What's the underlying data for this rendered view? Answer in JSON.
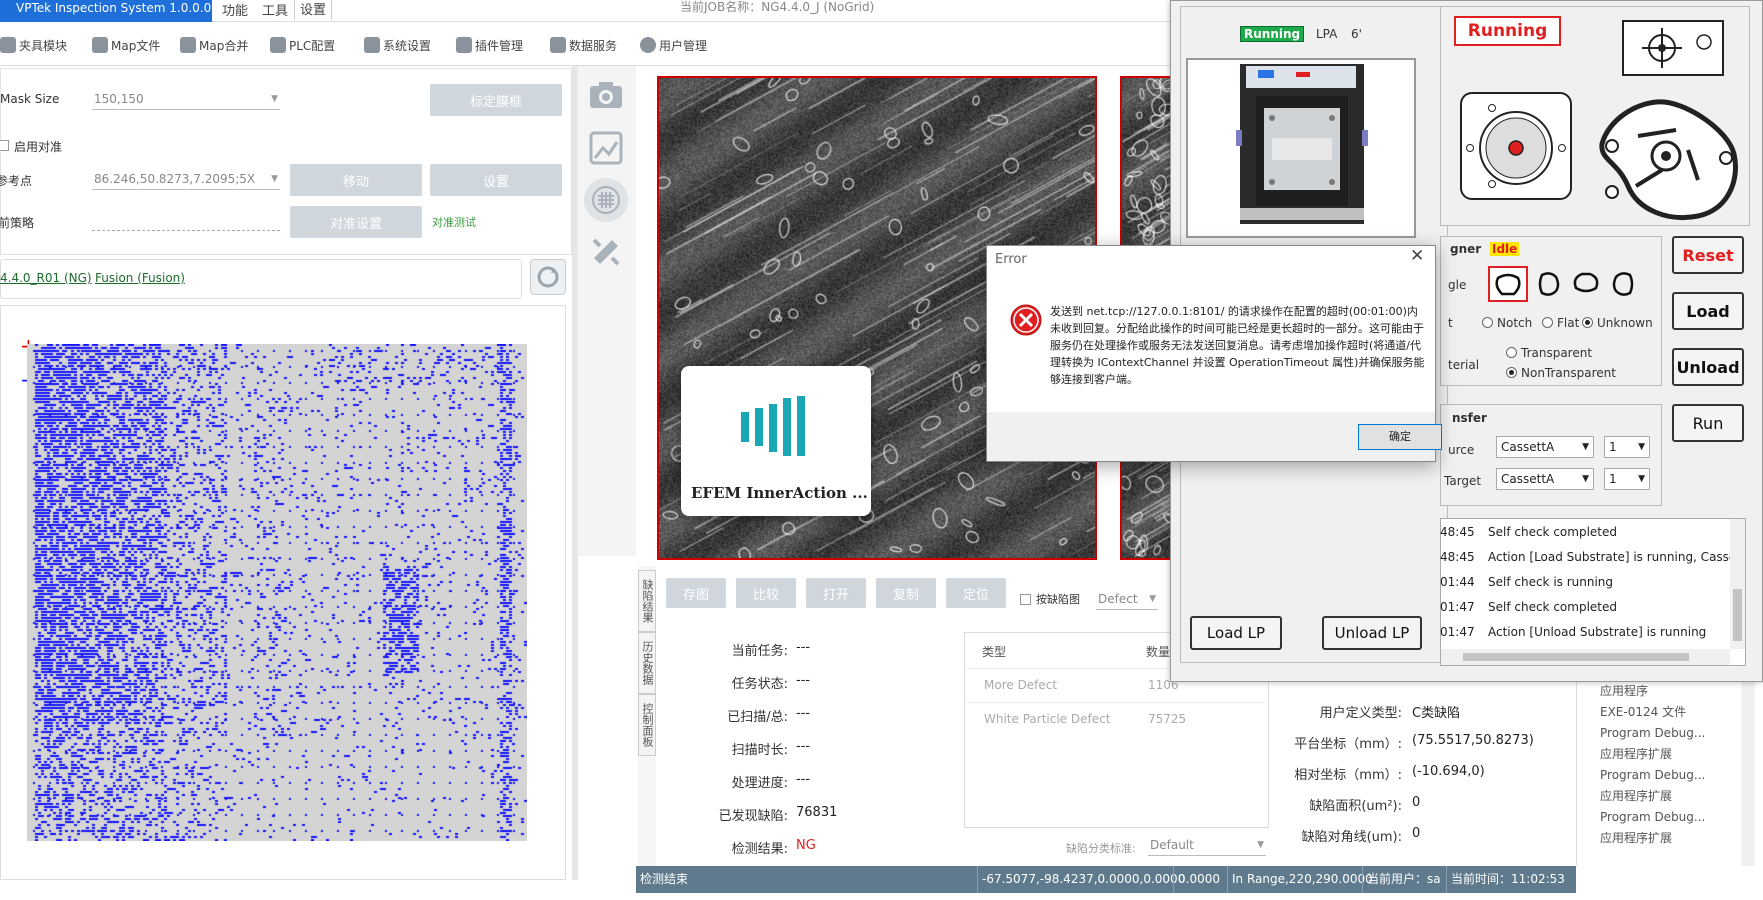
{
  "app": {
    "title": "VPTek Inspection System 1.0.0.0",
    "menu": [
      "功能",
      "工具",
      "设置"
    ],
    "job": "当前JOB名称：NG4.4.0_J (NoGrid)"
  },
  "toolbar": [
    "夹具模块",
    "Map文件",
    "Map合并",
    "PLC配置",
    "系统设置",
    "插件管理",
    "数据服务",
    "用户管理"
  ],
  "left": {
    "mask_size_label": "Mask Size",
    "mask_size_value": "150,150",
    "mark_button": "标定膜框",
    "enable_align": "启用对准",
    "ref_point_label": "参考点",
    "ref_point_value": "86.246,50.8273,7.2095;5X",
    "move_button": "移动",
    "set_button": "设置",
    "strategy_label": "前策略",
    "align_settings_button": "对准设置",
    "align_test": "对准测试",
    "recipe_link": "4.4.0_R01 (NG)",
    "fusion_link": "Fusion (Fusion)"
  },
  "inspection": {
    "buttons": [
      "存图",
      "比较",
      "打开",
      "复制",
      "定位"
    ],
    "by_defect_map": "按缺陷图",
    "defect_select": "Defect",
    "vtabs": [
      "缺陷结果",
      "历史数据",
      "控制面板"
    ],
    "stats": [
      {
        "label": "当前任务:",
        "value": "---"
      },
      {
        "label": "任务状态:",
        "value": "---"
      },
      {
        "label": "已扫描/总:",
        "value": "---"
      },
      {
        "label": "扫描时长:",
        "value": "---"
      },
      {
        "label": "处理进度:",
        "value": "---"
      },
      {
        "label": "已发现缺陷:",
        "value": "76831"
      },
      {
        "label": "检测结果:",
        "value": "NG"
      }
    ],
    "table_headers": [
      "类型",
      "数量"
    ],
    "table_rows": [
      [
        "More Defect",
        "1106"
      ],
      [
        "White Particle Defect",
        "75725"
      ]
    ],
    "classify_label": "缺陷分类标准:",
    "classify_value": "Default"
  },
  "detail": [
    {
      "label": "用户定义类型:",
      "value": "C类缺陷"
    },
    {
      "label": "平台坐标（mm）:",
      "value": "(75.5517,50.8273)"
    },
    {
      "label": "相对坐标（mm）:",
      "value": "(-10.694,0)"
    },
    {
      "label": "缺陷面积(um²):",
      "value": "0"
    },
    {
      "label": "缺陷对角线(um):",
      "value": "0"
    }
  ],
  "right_list": [
    "应用程序",
    "EXE-0124 文件",
    "Program Debug...",
    "应用程序扩展",
    "Program Debug...",
    "应用程序扩展",
    "Program Debug...",
    "应用程序扩展"
  ],
  "status_bar": [
    "检测结束",
    "-67.5077,-98.4237,0.0000,0.0000",
    "0.0000",
    "In Range,220,290.0000",
    "当前用户：sa",
    "当前时间：11:02:53"
  ],
  "splash": {
    "title": "EFEM InnerAction ..."
  },
  "efem": {
    "lp_status": "Running",
    "lp_label": "LPA",
    "lp_slot": "6'",
    "robot_status": "Running",
    "aligner_label": "gner",
    "aligner_status": "Idle",
    "angle_label": "gle",
    "notch_label": "t",
    "notch_options": [
      "Notch",
      "Flat",
      "Unknown"
    ],
    "material_label": "terial",
    "material_options": [
      "Transparent",
      "NonTransparent"
    ],
    "transfer_label": "nsfer",
    "source_label": "urce",
    "target_label": "Target",
    "source_value": "CassettA",
    "source_slot": "1",
    "target_value": "CassettA",
    "target_slot": "1",
    "buttons": {
      "reset": "Reset",
      "load": "Load",
      "unload": "Unload",
      "run": "Run",
      "load_lp": "Load LP",
      "unload_lp": "Unload LP"
    },
    "log": [
      {
        "time": "48:45",
        "msg": "Self check completed"
      },
      {
        "time": "48:45",
        "msg": "Action [Load Substrate] is running,  Casse"
      },
      {
        "time": "01:44",
        "msg": "Self check is running"
      },
      {
        "time": "01:47",
        "msg": "Self check completed"
      },
      {
        "time": "01:47",
        "msg": "Action [Unload Substrate] is running"
      }
    ]
  },
  "error_dialog": {
    "title": "Error",
    "message": "发送到 net.tcp://127.0.0.1:8101/ 的请求操作在配置的超时(00:01:00)内未收到回复。分配给此操作的时间可能已经是更长超时的一部分。这可能由于服务仍在处理操作或服务无法发送回复消息。请考虑增加操作超时(将通道/代理转换为 IContextChannel 并设置 OperationTimeout 属性)并确保服务能够连接到客户端。",
    "ok": "确定"
  },
  "colors": {
    "accent": "#1e6fd9",
    "blue_map": "#1515ff",
    "running_red": "#e02020",
    "idle_yellow": "#ffe600",
    "status_bar": "#5f7a8c",
    "teal": "#1aa7b5"
  }
}
